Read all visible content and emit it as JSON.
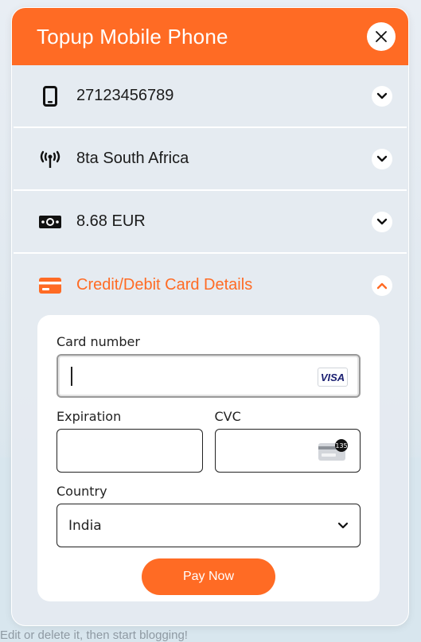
{
  "modal": {
    "title": "Topup Mobile Phone",
    "close_icon": "close-icon"
  },
  "rows": [
    {
      "icon": "mobile-phone-icon",
      "label": "27123456789"
    },
    {
      "icon": "antenna-icon",
      "label": "8ta South Africa"
    },
    {
      "icon": "money-icon",
      "label": "8.68 EUR"
    },
    {
      "icon": "credit-card-icon",
      "label": "Credit/Debit Card Details"
    }
  ],
  "card_form": {
    "card_number_label": "Card number",
    "card_number_value": "",
    "card_brand": "VISA",
    "expiration_label": "Expiration",
    "expiration_value": "",
    "cvc_label": "CVC",
    "cvc_value": "",
    "cvc_icon_text": "135",
    "country_label": "Country",
    "country_value": "India",
    "pay_button": "Pay Now"
  },
  "background_text": "Edit or delete it, then start blogging!",
  "colors": {
    "accent": "#ff6b24",
    "panel": "#ffffff",
    "text": "#1b1b1b"
  }
}
